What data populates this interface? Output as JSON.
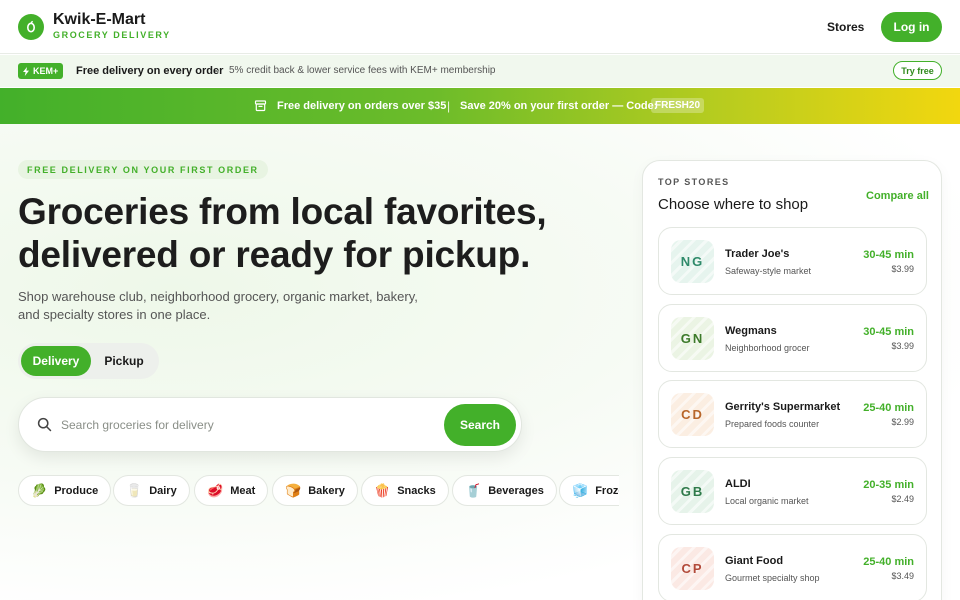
{
  "brand": {
    "name": "Kwik-E-Mart",
    "tagline": "GROCERY DELIVERY",
    "color": "#43b02a"
  },
  "nav": {
    "stores_label": "Stores",
    "login_label": "Log in"
  },
  "membership": {
    "badge": "KEM+",
    "headline": "Free delivery on every order",
    "separator": "·",
    "description": "5% credit back & lower service fees with KEM+ membership",
    "cta": "Try free"
  },
  "promo": {
    "text1": "Free delivery on orders over $35",
    "separator": "|",
    "text2": "Save 20% on your first order — Code:",
    "code": "FRESH20"
  },
  "hero": {
    "eyebrow": "FREE DELIVERY ON YOUR FIRST ORDER",
    "title_line1": "Groceries from local favorites,",
    "title_line2": "delivered or ready for pickup.",
    "subtitle": "Shop warehouse club, neighborhood grocery, organic market, bakery, and specialty stores in one place."
  },
  "mode": {
    "options": [
      "Delivery",
      "Pickup"
    ],
    "selected": "Delivery"
  },
  "search": {
    "placeholder": "Search groceries for delivery",
    "value": "",
    "button": "Search"
  },
  "categories": [
    {
      "label": "Produce",
      "icon": "lettuce-icon",
      "glyph": "🥬"
    },
    {
      "label": "Dairy",
      "icon": "milk-icon",
      "glyph": "🥛"
    },
    {
      "label": "Meat",
      "icon": "steak-icon",
      "glyph": "🥩"
    },
    {
      "label": "Bakery",
      "icon": "bread-icon",
      "glyph": "🍞"
    },
    {
      "label": "Snacks",
      "icon": "popcorn-icon",
      "glyph": "🍿"
    },
    {
      "label": "Beverages",
      "icon": "cup-icon",
      "glyph": "🥤"
    },
    {
      "label": "Frozen",
      "icon": "ice-cube-icon",
      "glyph": "🧊"
    }
  ],
  "stores_panel": {
    "eyebrow": "TOP STORES",
    "title": "Choose where to shop",
    "compare": "Compare all",
    "stores": [
      {
        "initials": "NG",
        "name": "Trader Joe's",
        "type": "Safeway-style market",
        "eta": "30-45 min",
        "fee": "$3.99",
        "tint": "#e6f4ee",
        "ink": "#2f8a6a"
      },
      {
        "initials": "GN",
        "name": "Wegmans",
        "type": "Neighborhood grocer",
        "eta": "30-45 min",
        "fee": "$3.99",
        "tint": "#ebf4e4",
        "ink": "#3c7a2a"
      },
      {
        "initials": "CD",
        "name": "Gerrity's Supermarket",
        "type": "Prepared foods counter",
        "eta": "25-40 min",
        "fee": "$2.99",
        "tint": "#fbeee2",
        "ink": "#b8662a"
      },
      {
        "initials": "GB",
        "name": "ALDI",
        "type": "Local organic market",
        "eta": "20-35 min",
        "fee": "$2.49",
        "tint": "#e6f3ea",
        "ink": "#2f7a4a"
      },
      {
        "initials": "CP",
        "name": "Giant Food",
        "type": "Gourmet specialty shop",
        "eta": "25-40 min",
        "fee": "$3.49",
        "tint": "#fbe9e4",
        "ink": "#b24a3a"
      }
    ]
  }
}
